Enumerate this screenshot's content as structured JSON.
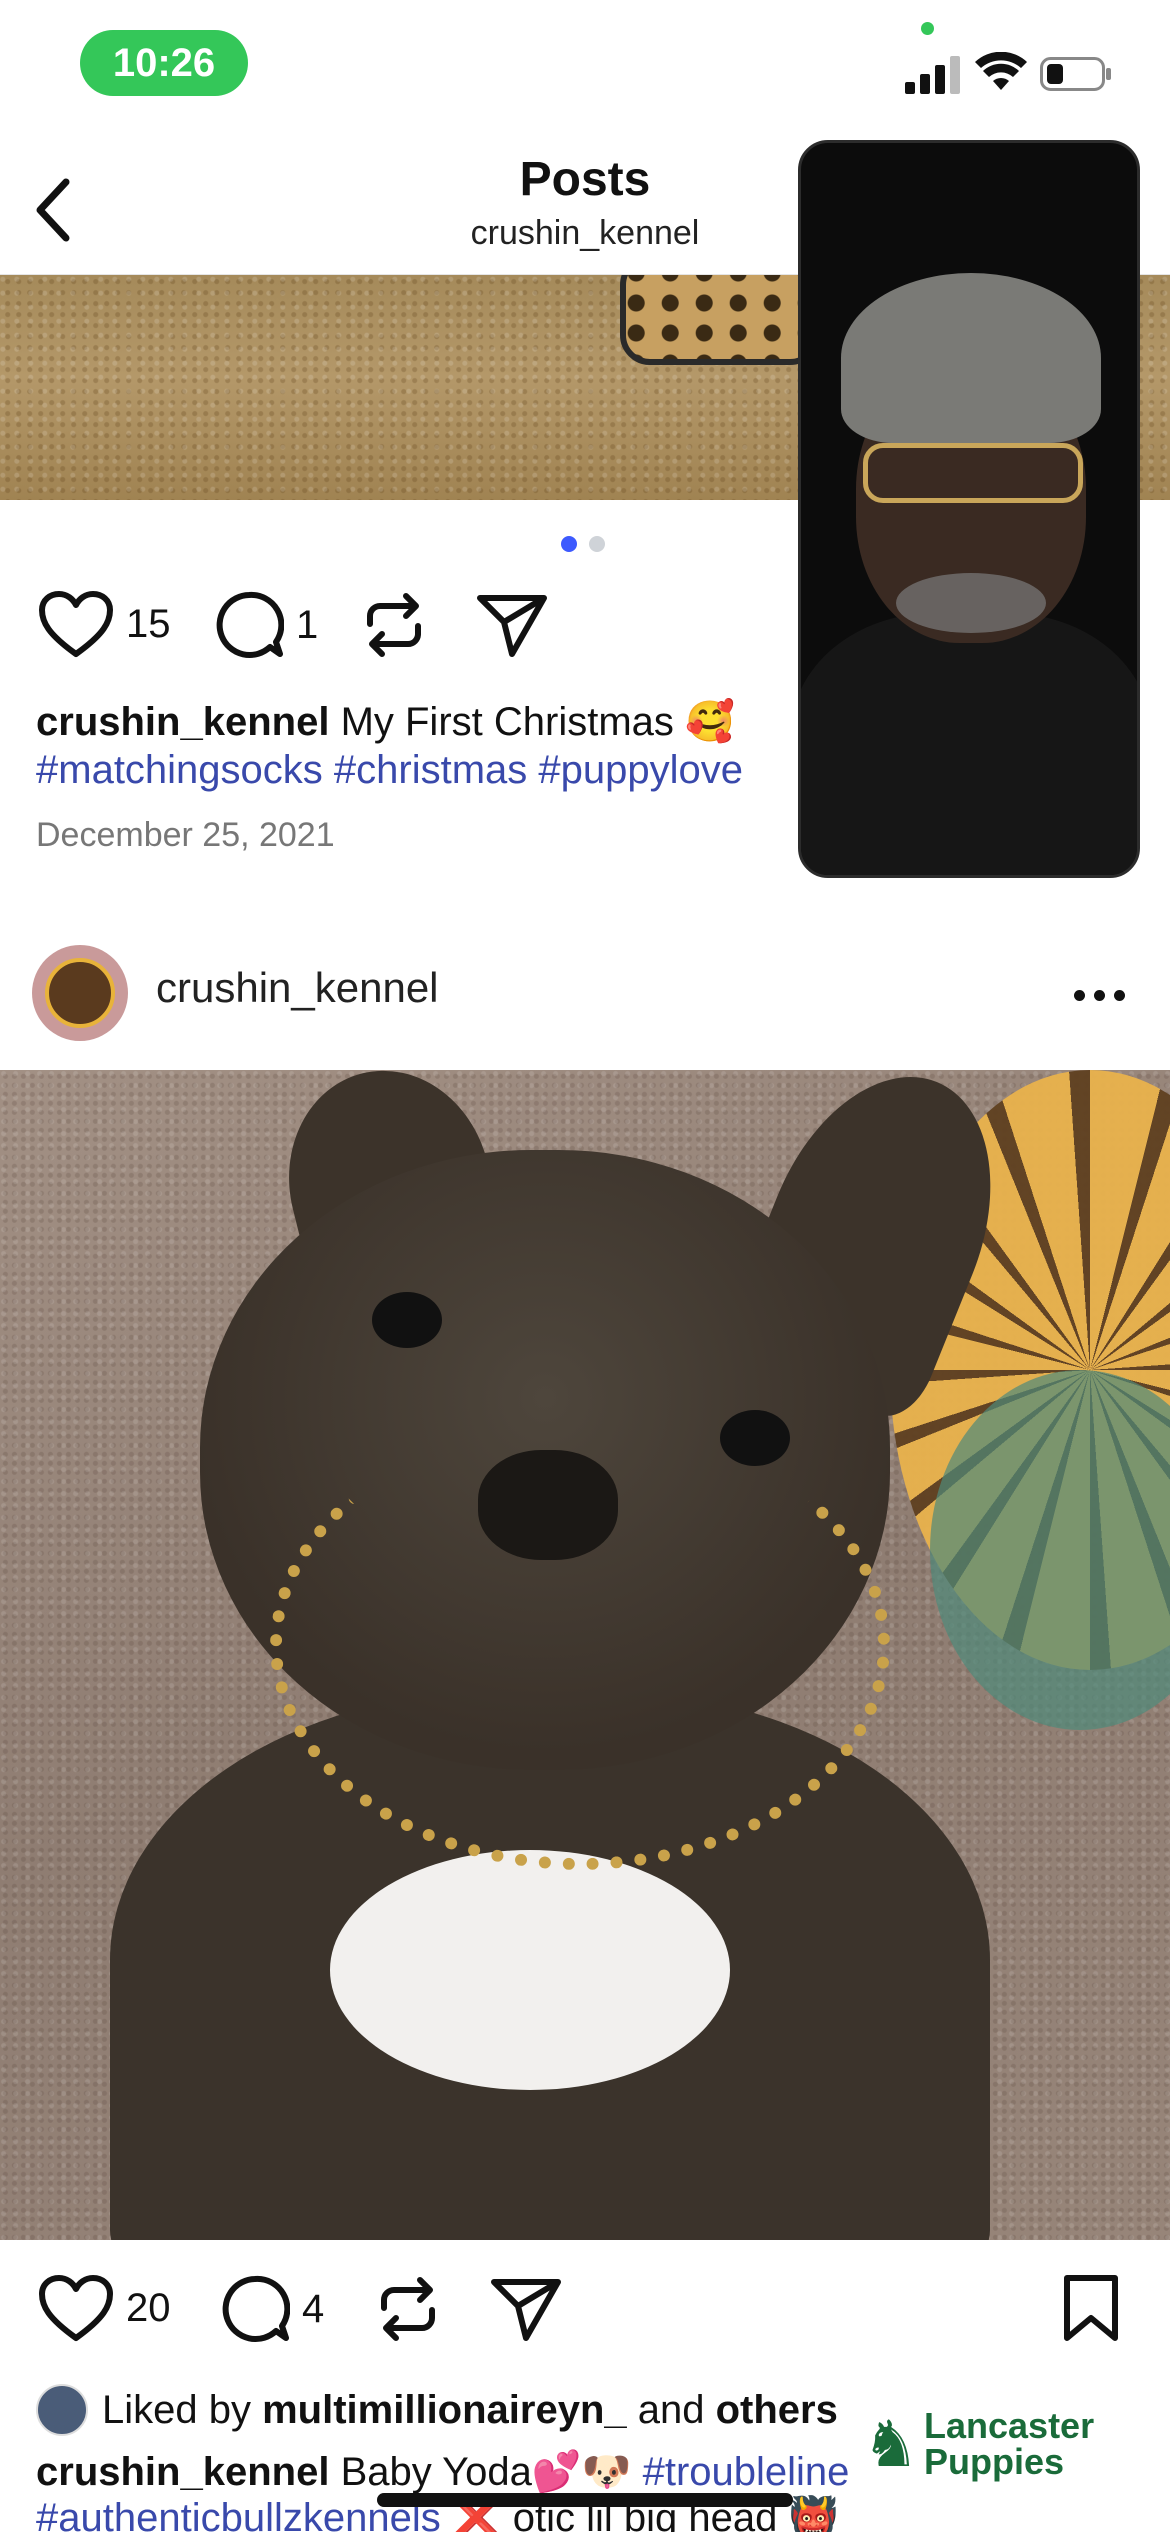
{
  "status_bar": {
    "time": "10:26",
    "accent_green": "#34c759"
  },
  "header": {
    "title": "Posts",
    "subtitle": "crushin_kennel",
    "back_icon": "chevron-left-icon"
  },
  "post1": {
    "carousel": {
      "pages": 2,
      "active": 1
    },
    "likes": "15",
    "comments": "1",
    "caption_user": "crushin_kennel",
    "caption_text": "My First Christmas 🥰",
    "hashtags": "#matchingsocks #christmas #puppylove",
    "date": "December 25, 2021"
  },
  "post2": {
    "username": "crushin_kennel",
    "more_icon": "more-horizontal-icon",
    "likes": "20",
    "comments": "4",
    "liked_by_prefix": "Liked by ",
    "liked_by_user": "multimillionaireyn_",
    "liked_by_and": " and ",
    "liked_by_others": "others",
    "caption_user": "crushin_kennel",
    "caption_text": "Baby Yoda💕🐶",
    "caption_hashtag": "#troubleline",
    "caption_line2_hashtag": "#authenticbullzkennels",
    "caption_line2_text": "❌ otic lil big head 👹"
  },
  "watermark": {
    "line1": "Lancaster",
    "line2": "Puppies",
    "color": "#1a6b3a"
  },
  "colors": {
    "hashtag_blue": "#3949ab",
    "carousel_active": "#3d5afe"
  }
}
